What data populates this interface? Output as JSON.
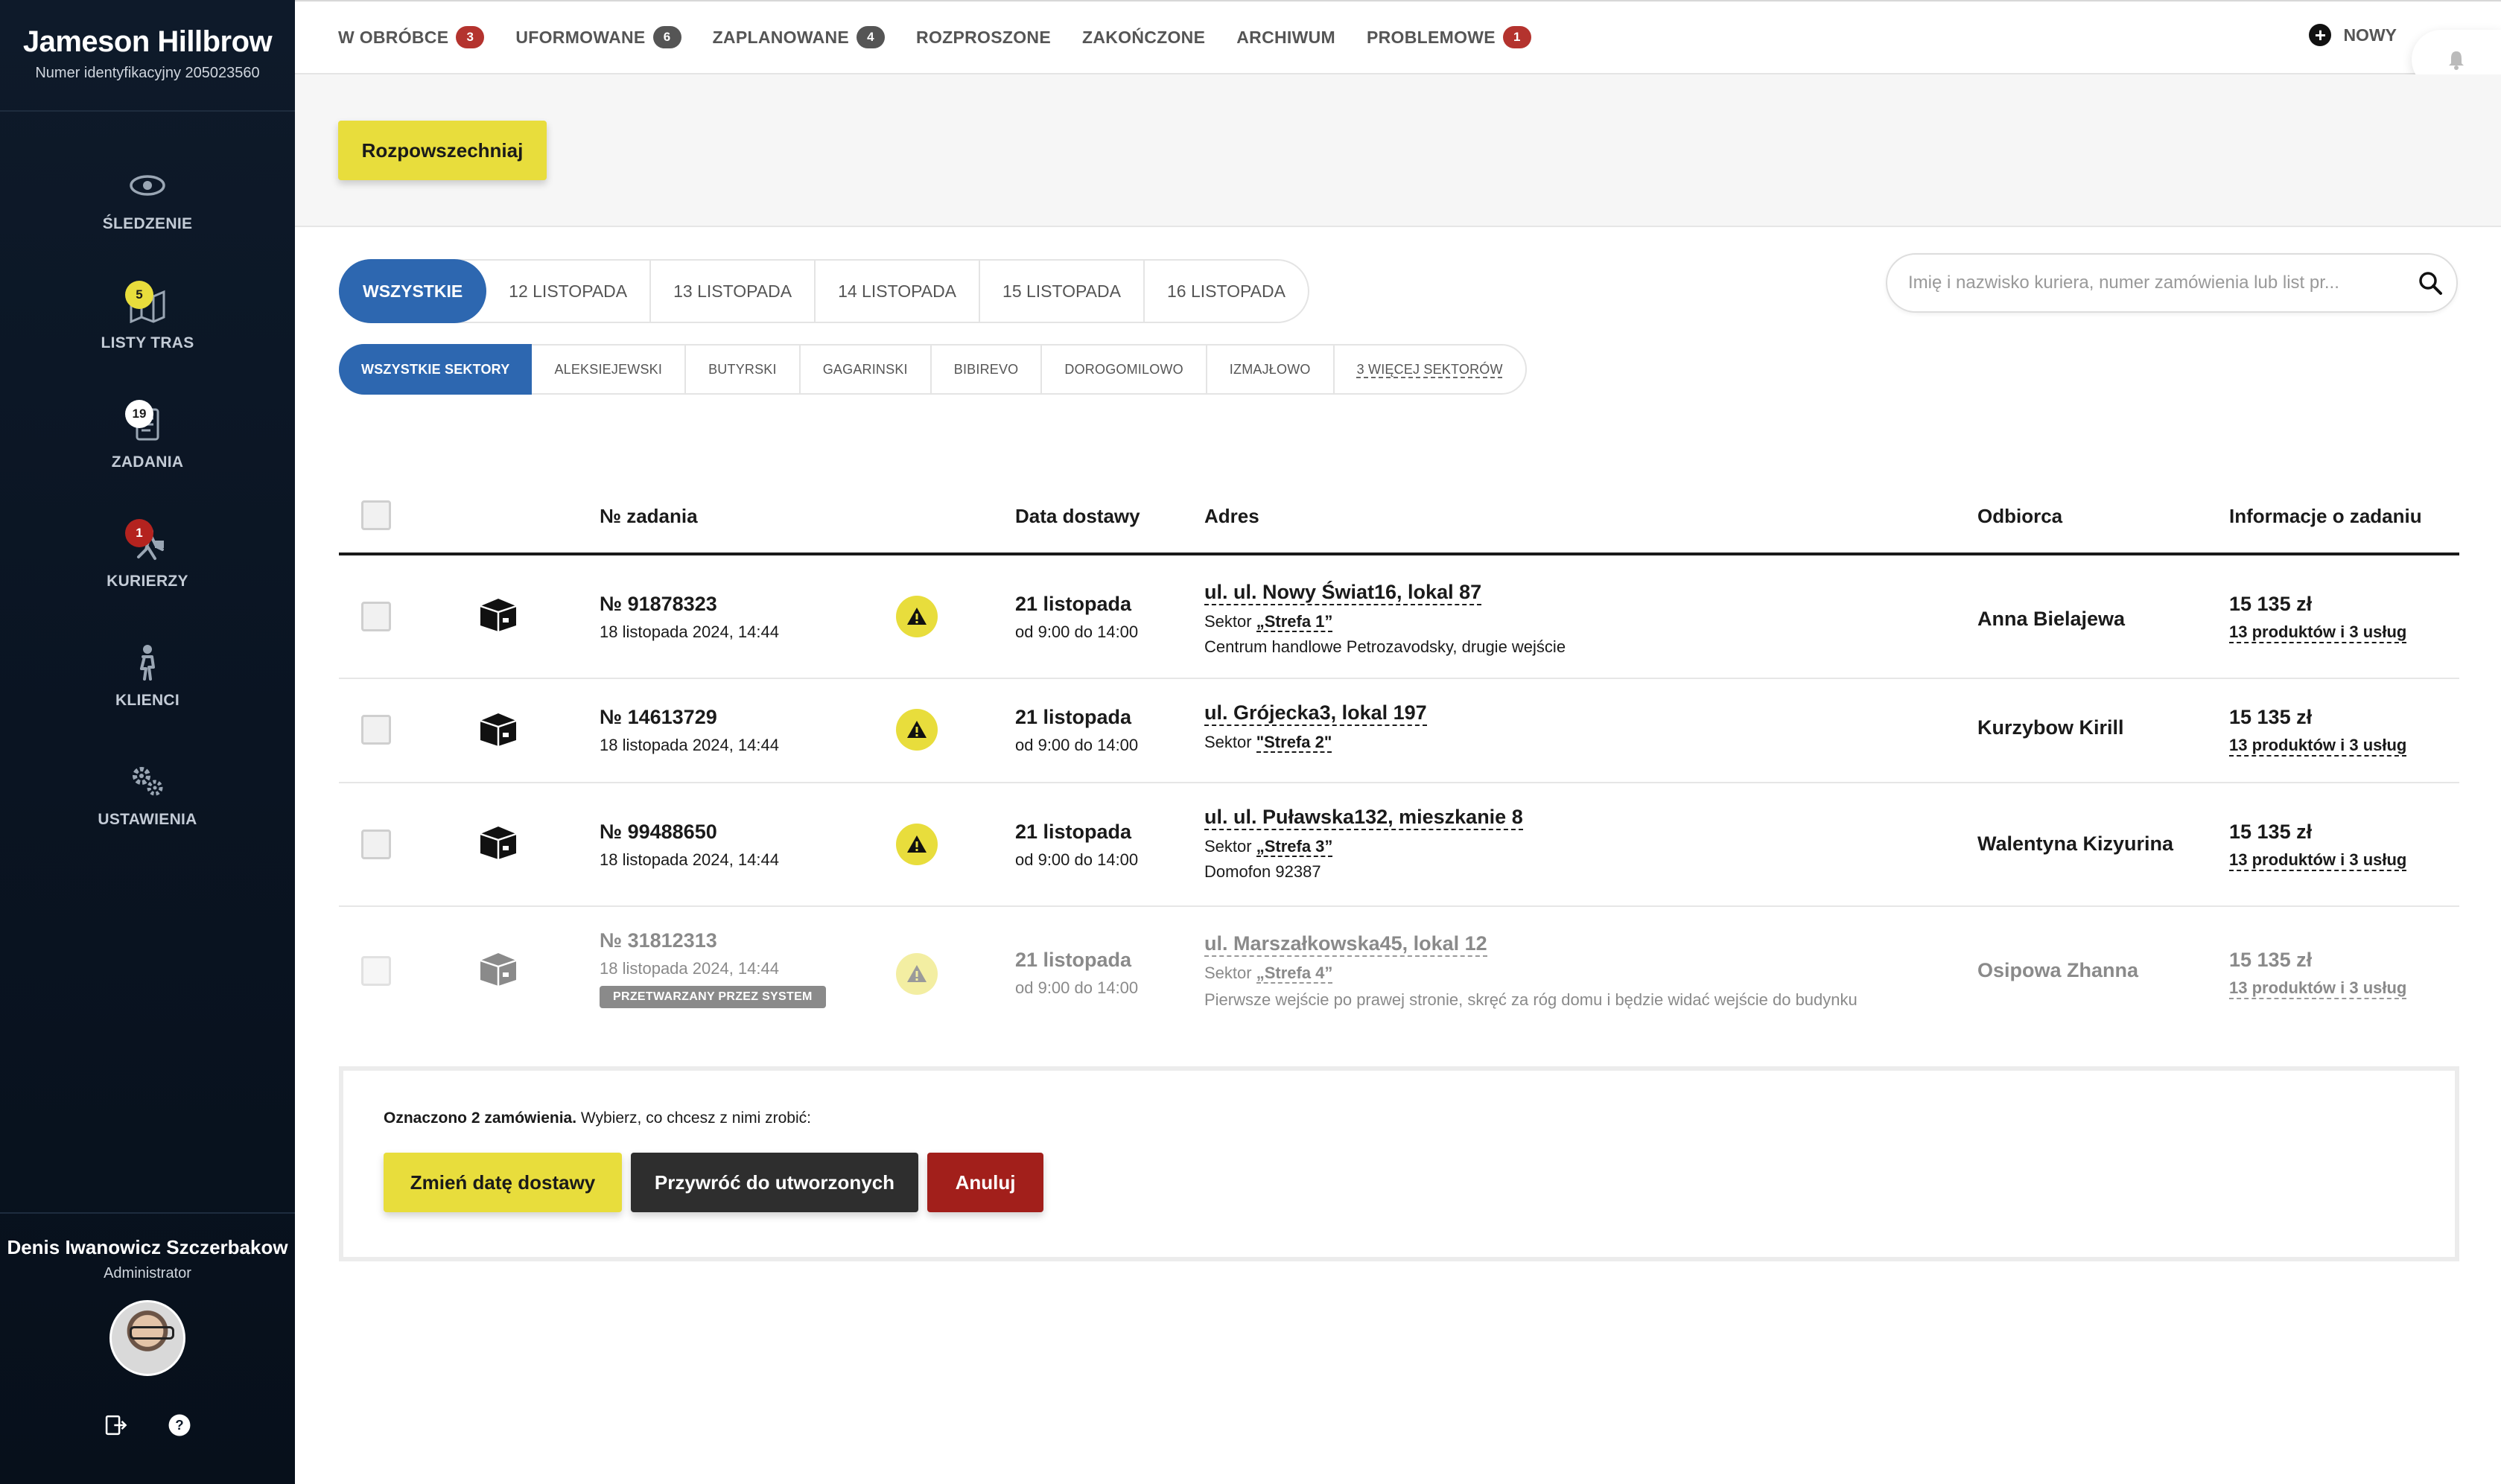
{
  "brand": {
    "name": "Jameson Hillbrow",
    "id_text": "Numer identyfikacyjny 205023560"
  },
  "sidebar": {
    "items": [
      {
        "label": "ŚLEDZENIE",
        "icon": "eye-icon",
        "badge": ""
      },
      {
        "label": "LISTY TRAS",
        "icon": "route-map-icon",
        "badge": "5"
      },
      {
        "label": "ZADANIA",
        "icon": "clipboard-icon",
        "badge": "19"
      },
      {
        "label": "KURIERZY",
        "icon": "courier-icon",
        "badge": "1"
      },
      {
        "label": "KLIENCI",
        "icon": "client-icon",
        "badge": ""
      },
      {
        "label": "USTAWIENIA",
        "icon": "gears-icon",
        "badge": ""
      }
    ],
    "user": {
      "name": "Denis Iwanowicz Szczerbakow",
      "role": "Administrator"
    }
  },
  "topbar": {
    "tabs": [
      {
        "label": "W OBRÓBCE",
        "count": "3"
      },
      {
        "label": "UFORMOWANE",
        "count": "6"
      },
      {
        "label": "ZAPLANOWANE",
        "count": "4"
      },
      {
        "label": "ROZPROSZONE",
        "count": ""
      },
      {
        "label": "ZAKOŃCZONE",
        "count": ""
      },
      {
        "label": "ARCHIWUM",
        "count": ""
      },
      {
        "label": "PROBLEMOWE",
        "count": "1"
      }
    ],
    "new_label": "NOWY"
  },
  "actions": {
    "distribute_label": "Rozpowszechniaj"
  },
  "filters": {
    "dates": [
      "WSZYSTKIE",
      "12 LISTOPADA",
      "13 LISTOPADA",
      "14 LISTOPADA",
      "15 LISTOPADA",
      "16 LISTOPADA"
    ],
    "sectors": [
      "WSZYSTKIE SEKTORY",
      "ALEKSIEJEWSKI",
      "BUTYRSKI",
      "GAGARINSKI",
      "BIBIREVO",
      "DOROGOMILOWO",
      "IZMAJŁOWO",
      "3 WIĘCEJ SEKTORÓW"
    ],
    "search_placeholder": "Imię i nazwisko kuriera, numer zamówienia lub list pr..."
  },
  "table": {
    "headers": {
      "order": "№ zadania",
      "delivery": "Data dostawy",
      "address": "Adres",
      "recipient": "Odbiorca",
      "info": "Informacje o zadaniu"
    },
    "rows": [
      {
        "order_no": "№ 91878323",
        "created": "18 listopada 2024, 14:44",
        "delivery_date": "21 listopada",
        "delivery_time": "od 9:00 do 14:00",
        "address": "ul. ul. Nowy Świat16, lokal 87",
        "sector_prefix": "Sektor ",
        "sector": "„Strefa 1”",
        "note": "Centrum handlowe Petrozavodsky, drugie wejście",
        "recipient": "Anna Bielajewa",
        "price": "15 135 zł",
        "items": "13 produktów i 3 usług",
        "badge": ""
      },
      {
        "order_no": "№ 14613729",
        "created": "18 listopada 2024, 14:44",
        "delivery_date": "21 listopada",
        "delivery_time": "od 9:00 do 14:00",
        "address": "ul. Grójecka3, lokal 197",
        "sector_prefix": "Sektor ",
        "sector": "\"Strefa 2\"",
        "note": "",
        "recipient": "Kurzybow Kirill",
        "price": "15 135 zł",
        "items": "13 produktów i 3 usług",
        "badge": ""
      },
      {
        "order_no": "№ 99488650",
        "created": "18 listopada 2024, 14:44",
        "delivery_date": "21 listopada",
        "delivery_time": "od 9:00 do 14:00",
        "address": "ul. ul. Puławska132, mieszkanie 8",
        "sector_prefix": "Sektor ",
        "sector": "„Strefa 3”",
        "note": "Domofon 92387",
        "recipient": "Walentyna Kizyurina",
        "price": "15 135 zł",
        "items": "13 produktów i 3 usług",
        "badge": ""
      },
      {
        "order_no": "№ 31812313",
        "created": "18 listopada 2024, 14:44",
        "delivery_date": "21 listopada",
        "delivery_time": "od 9:00 do 14:00",
        "address": "ul. Marszałkowska45, lokal 12",
        "sector_prefix": "Sektor ",
        "sector": "„Strefa 4”",
        "note": "Pierwsze wejście po prawej stronie, skręć za róg domu i będzie widać wejście do budynku",
        "recipient": "Osipowa Zhanna",
        "price": "15 135 zł",
        "items": "13 produktów i 3 usług",
        "badge": "PRZETWARZANY PRZEZ SYSTEM"
      }
    ]
  },
  "selection": {
    "count_text": "Oznaczono 2 zamówienia.",
    "prompt": " Wybierz, co chcesz z nimi zrobić:",
    "change_label": "Zmień datę dostawy",
    "restore_label": "Przywróć do utworzonych",
    "cancel_label": "Anuluj"
  },
  "colors": {
    "accent_yellow": "#e8dd3c",
    "accent_blue": "#2d67b0",
    "danger_red": "#a21f1b",
    "sidebar_bg": "#0e1a2a"
  }
}
